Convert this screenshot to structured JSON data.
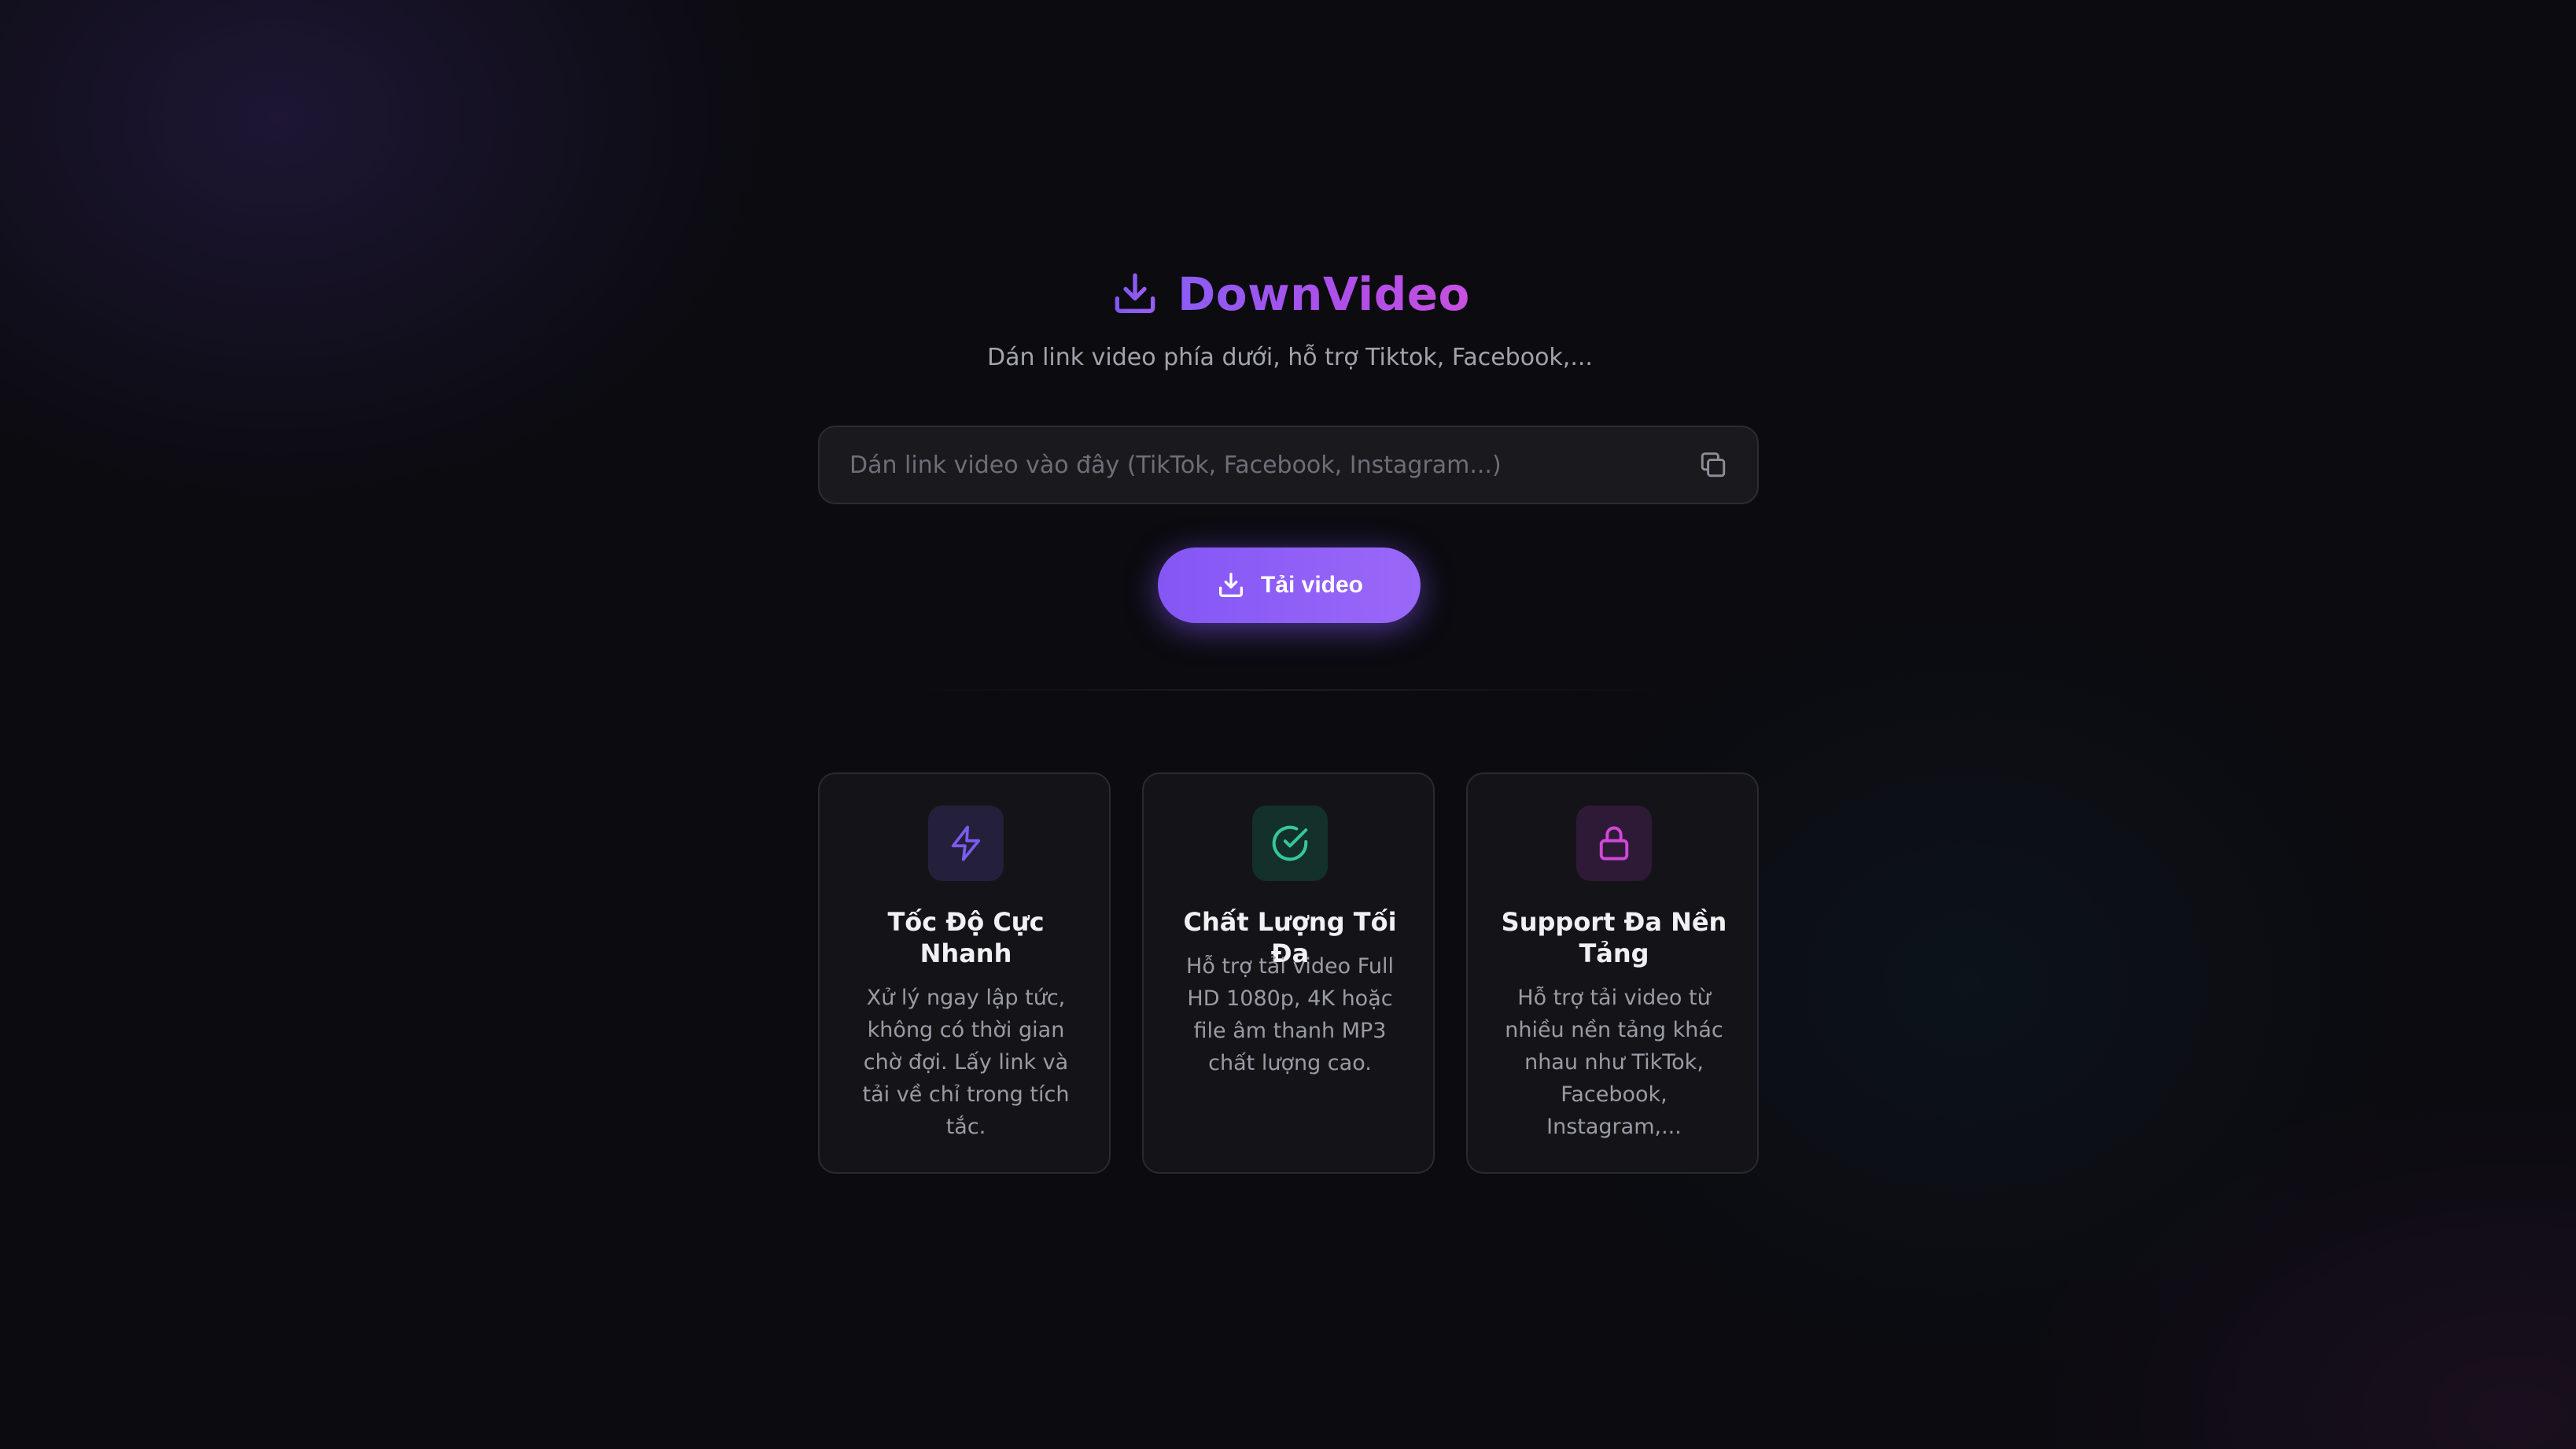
{
  "brand": {
    "name": "DownVideo",
    "icon": "download-icon"
  },
  "subtitle": "Dán link video phía dưới, hỗ trợ Tiktok, Facebook,...",
  "search": {
    "placeholder": "Dán link video vào đây (TikTok, Facebook, Instagram...)",
    "value": "",
    "paste_icon": "copy-icon"
  },
  "download_button": {
    "label": "Tải video",
    "icon": "download-icon"
  },
  "features": [
    {
      "title": "Tốc Độ Cực Nhanh",
      "description": "Xử lý ngay lập tức, không có thời gian chờ đợi. Lấy link và tải về chỉ trong tích tắc.",
      "icon": "lightning-icon",
      "accent": "#7c5cf0"
    },
    {
      "title": "Chất Lượng Tối Đa",
      "description": "Hỗ trợ tải video Full HD 1080p, 4K hoặc file âm thanh MP3 chất lượng cao.",
      "icon": "check-circle-icon",
      "accent": "#34c79a"
    },
    {
      "title": "Support Đa Nền Tảng",
      "description": "Hỗ trợ tải video từ nhiều nền tảng khác nhau như TikTok, Facebook, Instagram,...",
      "icon": "lock-icon",
      "accent": "#d048d8"
    }
  ],
  "colors": {
    "background": "#0b0b10",
    "brand_gradient_start": "#8b5cf6",
    "brand_gradient_end": "#c850e0",
    "button": "#8456f5"
  }
}
